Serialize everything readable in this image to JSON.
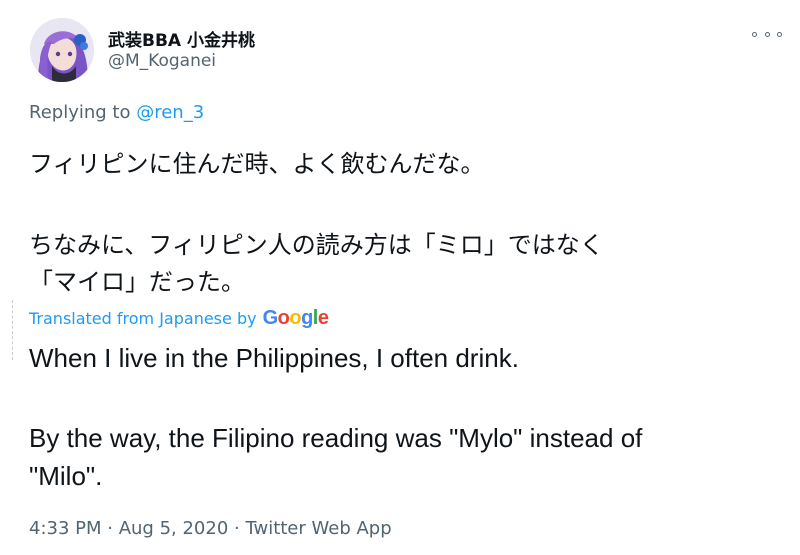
{
  "author": {
    "display_name": "武装BBA 小金井桃",
    "handle": "@M_Koganei",
    "avatar": "anime-avatar"
  },
  "more_icon": "more-horizontal-icon",
  "reply": {
    "prefix": "Replying to ",
    "mention": "@ren_3"
  },
  "original_text": {
    "line1": "フィリピンに住んだ時、よく飲むんだな。",
    "line2": "ちなみに、フィリピン人の読み方は「ミロ」ではなく",
    "line3": "「マイロ」だった。"
  },
  "translation": {
    "label": "Translated from Japanese by",
    "provider_letters": [
      "G",
      "o",
      "o",
      "g",
      "l",
      "e"
    ],
    "line1": "When I live in the Philippines, I often drink.",
    "line2": " By the way, the Filipino reading was \"Mylo\" instead of",
    "line3": "\"Milo\"."
  },
  "meta": {
    "time": "4:33 PM",
    "separator1": " · ",
    "date": "Aug 5, 2020",
    "separator2": " · ",
    "source": "Twitter Web App"
  },
  "colors": {
    "link": "#1d9bf0",
    "secondary_text": "#536471",
    "primary_text": "#0f1419"
  }
}
